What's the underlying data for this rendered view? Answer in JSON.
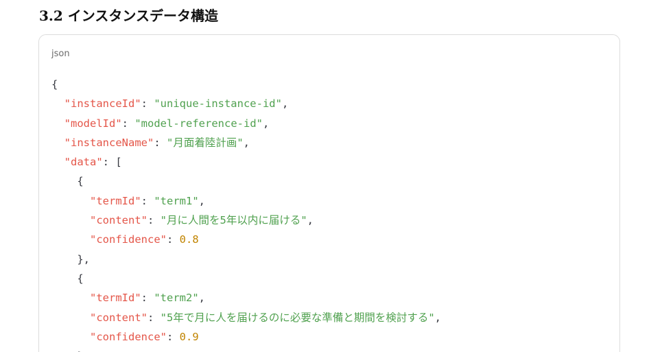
{
  "section": {
    "title": "3.2 インスタンスデータ構造"
  },
  "code_block": {
    "language": "json",
    "lines": [
      [
        {
          "t": "punc",
          "v": "{"
        }
      ],
      [
        {
          "t": "punc",
          "v": "  "
        },
        {
          "t": "key",
          "v": "\"instanceId\""
        },
        {
          "t": "punc",
          "v": ": "
        },
        {
          "t": "str",
          "v": "\"unique-instance-id\""
        },
        {
          "t": "punc",
          "v": ","
        }
      ],
      [
        {
          "t": "punc",
          "v": "  "
        },
        {
          "t": "key",
          "v": "\"modelId\""
        },
        {
          "t": "punc",
          "v": ": "
        },
        {
          "t": "str",
          "v": "\"model-reference-id\""
        },
        {
          "t": "punc",
          "v": ","
        }
      ],
      [
        {
          "t": "punc",
          "v": "  "
        },
        {
          "t": "key",
          "v": "\"instanceName\""
        },
        {
          "t": "punc",
          "v": ": "
        },
        {
          "t": "str",
          "v": "\"月面着陸計画\""
        },
        {
          "t": "punc",
          "v": ","
        }
      ],
      [
        {
          "t": "punc",
          "v": "  "
        },
        {
          "t": "key",
          "v": "\"data\""
        },
        {
          "t": "punc",
          "v": ": ["
        }
      ],
      [
        {
          "t": "punc",
          "v": "    {"
        }
      ],
      [
        {
          "t": "punc",
          "v": "      "
        },
        {
          "t": "key",
          "v": "\"termId\""
        },
        {
          "t": "punc",
          "v": ": "
        },
        {
          "t": "str",
          "v": "\"term1\""
        },
        {
          "t": "punc",
          "v": ","
        }
      ],
      [
        {
          "t": "punc",
          "v": "      "
        },
        {
          "t": "key",
          "v": "\"content\""
        },
        {
          "t": "punc",
          "v": ": "
        },
        {
          "t": "str",
          "v": "\"月に人間を5年以内に届ける\""
        },
        {
          "t": "punc",
          "v": ","
        }
      ],
      [
        {
          "t": "punc",
          "v": "      "
        },
        {
          "t": "key",
          "v": "\"confidence\""
        },
        {
          "t": "punc",
          "v": ": "
        },
        {
          "t": "num",
          "v": "0.8"
        }
      ],
      [
        {
          "t": "punc",
          "v": "    },"
        }
      ],
      [
        {
          "t": "punc",
          "v": "    {"
        }
      ],
      [
        {
          "t": "punc",
          "v": "      "
        },
        {
          "t": "key",
          "v": "\"termId\""
        },
        {
          "t": "punc",
          "v": ": "
        },
        {
          "t": "str",
          "v": "\"term2\""
        },
        {
          "t": "punc",
          "v": ","
        }
      ],
      [
        {
          "t": "punc",
          "v": "      "
        },
        {
          "t": "key",
          "v": "\"content\""
        },
        {
          "t": "punc",
          "v": ": "
        },
        {
          "t": "str",
          "v": "\"5年で月に人を届けるのに必要な準備と期間を検討する\""
        },
        {
          "t": "punc",
          "v": ","
        }
      ],
      [
        {
          "t": "punc",
          "v": "      "
        },
        {
          "t": "key",
          "v": "\"confidence\""
        },
        {
          "t": "punc",
          "v": ": "
        },
        {
          "t": "num",
          "v": "0.9"
        }
      ],
      [
        {
          "t": "punc",
          "v": "    }"
        }
      ]
    ]
  },
  "colors": {
    "key": "#e45649",
    "string": "#50a14f",
    "number": "#c18401",
    "punctuation": "#383a42"
  }
}
